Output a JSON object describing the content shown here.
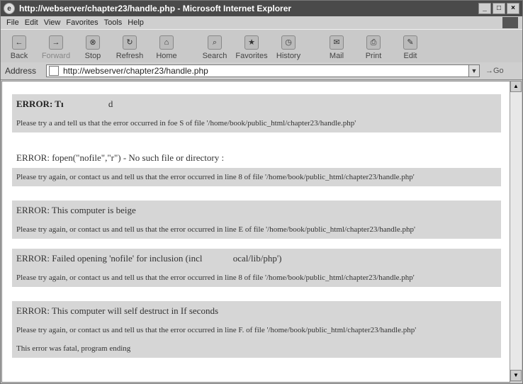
{
  "window": {
    "title": "http://webserver/chapter23/handle.php - Microsoft Internet Explorer",
    "controls": [
      "_",
      "□",
      "×"
    ]
  },
  "menu": [
    "File",
    "Edit",
    "View",
    "Favorites",
    "Tools",
    "Help"
  ],
  "toolbar": [
    {
      "label": "Back",
      "icon": "back-arrow-icon"
    },
    {
      "label": "Forward",
      "icon": "forward-arrow-icon"
    },
    {
      "label": "Stop",
      "icon": "stop-icon"
    },
    {
      "label": "Refresh",
      "icon": "refresh-icon"
    },
    {
      "label": "Home",
      "icon": "home-icon"
    },
    {
      "label": "Search",
      "icon": "search-icon"
    },
    {
      "label": "Favorites",
      "icon": "favorites-icon"
    },
    {
      "label": "History",
      "icon": "history-icon"
    },
    {
      "label": "Mail",
      "icon": "mail-icon"
    },
    {
      "label": "Print",
      "icon": "print-icon"
    },
    {
      "label": "Edit",
      "icon": "edit-icon"
    }
  ],
  "address": {
    "label": "Address",
    "url": "http://webserver/chapter23/handle.php",
    "go": "Go"
  },
  "errors": [
    {
      "error": "ERROR: Tı",
      "detail": "d",
      "msg": "Please try  a   and  tell  us  that the  error  occurred  in  foe  S of file '/home/book/public_html/chapter23/handle.php'"
    },
    {
      "error": "ERROR: fopen(\"nofile\",\"r\") - No such file or directory :",
      "detail": "",
      "msg": "Please try again, or contact us and tell us that the error occurred in line 8 of file '/home/book/public_html/chapter23/handle.php'"
    },
    {
      "error": "ERROR: This computer is beige",
      "detail": "",
      "msg": "Please try again, or contact us and tell us that the error occurred in line E of file '/home/book/public_html/chapter23/handle.php'"
    },
    {
      "error": "ERROR: Failed opening 'nofile' for inclusion (incl",
      "detail": "ocal/lib/php')",
      "msg": "Please try again, or contact us and tell us that the error occurred in line 8 of file '/home/book/public_html/chapter23/handle.php'"
    },
    {
      "error": "ERROR: This computer will self destruct in  If  seconds",
      "detail": "",
      "msg": "Please try again, or contact us and tell us that the error occurred in line F. of file '/home/book/public_html/chapter23/handle.php'"
    }
  ],
  "fatal": "This error was fatal, program ending"
}
